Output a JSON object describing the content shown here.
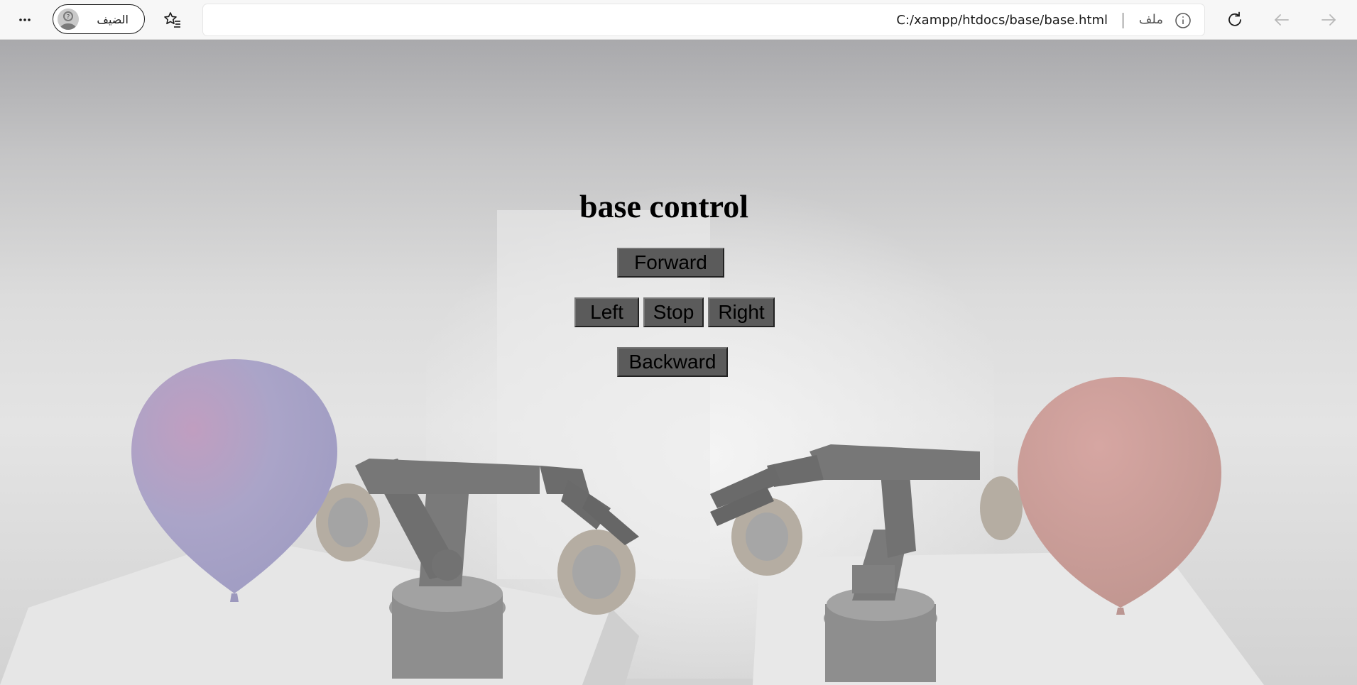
{
  "browser": {
    "url": "C:/xampp/htdocs/base/base.html",
    "file_label": "ملف",
    "profile_name": "الضيف",
    "icons": [
      "more-icon",
      "guest-avatar-icon",
      "favorites-icon",
      "info-icon",
      "refresh-icon",
      "back-icon",
      "forward-icon"
    ]
  },
  "page": {
    "title": "base control",
    "buttons": {
      "forward": "Forward",
      "left": "Left",
      "stop": "Stop",
      "right": "Right",
      "backward": "Backward"
    }
  },
  "colors": {
    "button_bg": "#5b5b5b",
    "toolbar_bg": "#f7f7f7",
    "balloon_left": "#a8a3c6",
    "balloon_right": "#c9a09c"
  }
}
